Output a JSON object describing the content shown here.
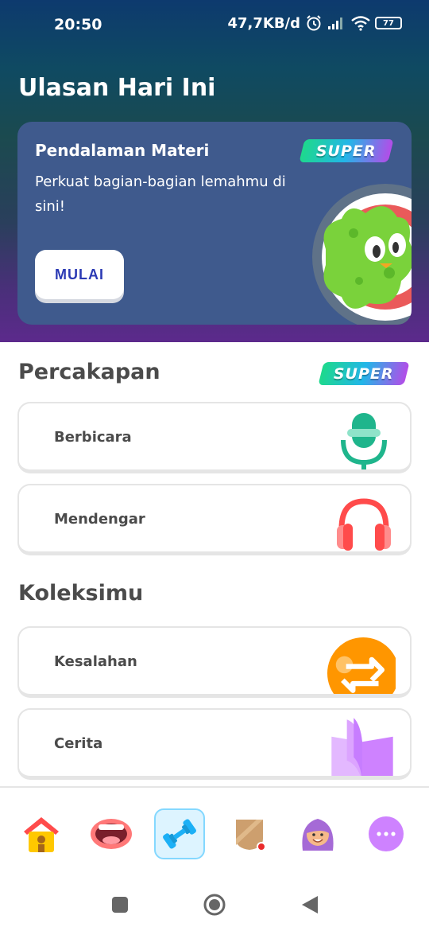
{
  "status_bar": {
    "time": "20:50",
    "network_speed": "47,7KB/d",
    "battery": "77",
    "icons": [
      "alarm-icon",
      "signal-icon",
      "wifi-icon",
      "battery-icon"
    ]
  },
  "header": {
    "title": "Ulasan Hari Ini"
  },
  "feature_card": {
    "title": "Pendalaman Materi",
    "description": "Perkuat bagian-bagian lemahmu di sini!",
    "badge": "SUPER",
    "button_label": "MULAI"
  },
  "conversation": {
    "title": "Percakapan",
    "badge": "SUPER",
    "items": [
      {
        "label": "Berbicara",
        "icon": "microphone-icon"
      },
      {
        "label": "Mendengar",
        "icon": "headphones-icon"
      }
    ]
  },
  "collection": {
    "title": "Koleksimu",
    "items": [
      {
        "label": "Kesalahan",
        "icon": "repeat-icon"
      },
      {
        "label": "Cerita",
        "icon": "book-icon"
      }
    ]
  },
  "bottom_nav": {
    "items": [
      "home-icon",
      "mouth-icon",
      "dumbbell-icon",
      "shield-icon",
      "avatar-icon",
      "more-icon"
    ],
    "active_index": 2
  },
  "colors": {
    "accent_blue": "#2b3ab4",
    "card_bg": "#3f5a8d",
    "speak_green": "#1fb58c",
    "listen_red": "#ff4b4b",
    "mistakes_orange": "#ff9600",
    "story_purple": "#ce82ff"
  }
}
